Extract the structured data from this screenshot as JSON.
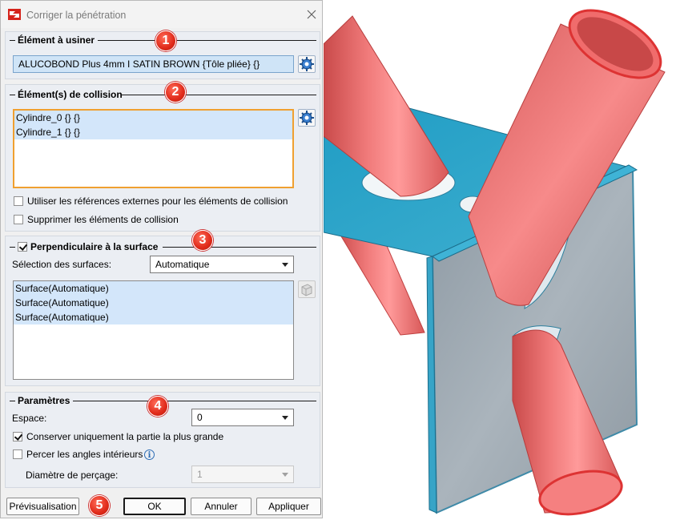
{
  "window": {
    "title": "Corriger la pénétration"
  },
  "sections": {
    "element_a_usiner": {
      "title": "Élément à usiner",
      "value": "ALUCOBOND Plus 4mm I SATIN BROWN {Tôle pliée} {}",
      "badge": "1"
    },
    "collision": {
      "title": "Élément(s) de collision",
      "items": [
        "Cylindre_0 {} {}",
        "Cylindre_1 {} {}"
      ],
      "badge": "2",
      "external_refs_label": "Utiliser les références externes pour les éléments de collision",
      "external_refs_checked": false,
      "delete_label": "Supprimer les éléments de collision",
      "delete_checked": false
    },
    "perpendicular": {
      "title": "Perpendiculaire à la surface",
      "checked": true,
      "badge": "3",
      "selection_label": "Sélection des surfaces:",
      "selection_value": "Automatique",
      "surfaces": [
        "Surface(Automatique)",
        "Surface(Automatique)",
        "Surface(Automatique)"
      ]
    },
    "parametres": {
      "title": "Paramètres",
      "badge": "4",
      "espace_label": "Espace:",
      "espace_value": "0",
      "keep_largest_label": "Conserver uniquement la partie la plus grande",
      "keep_largest_checked": true,
      "drill_label": "Percer les angles intérieurs",
      "drill_checked": false,
      "diameter_label": "Diamètre de perçage:",
      "diameter_value": "1"
    }
  },
  "buttons": {
    "preview": "Prévisualisation",
    "badge": "5",
    "ok": "OK",
    "cancel": "Annuler",
    "apply": "Appliquer"
  },
  "colors": {
    "sheet": "#3aa6c8",
    "cylinder": "#e86060",
    "badge": "#e02a1a",
    "focus": "#f0a030"
  }
}
